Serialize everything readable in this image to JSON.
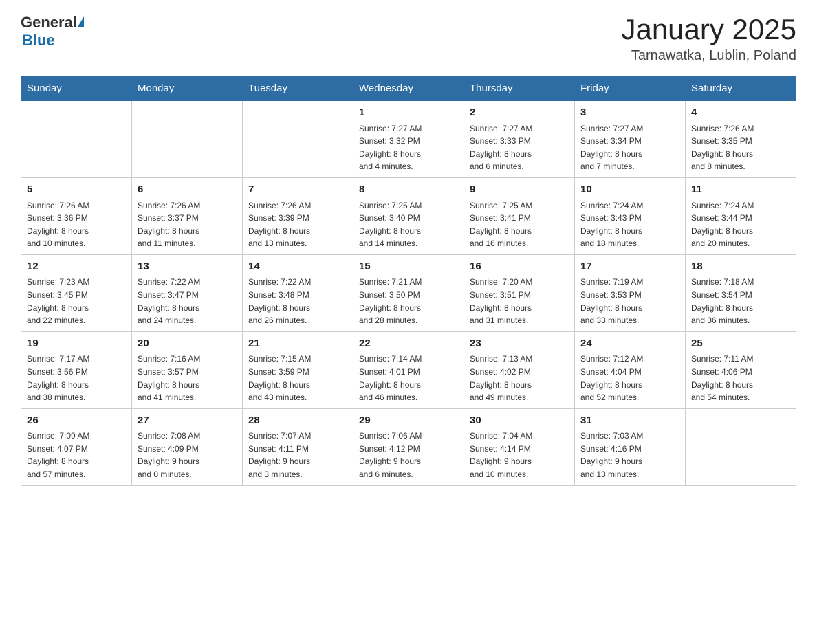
{
  "header": {
    "title": "January 2025",
    "subtitle": "Tarnawatka, Lublin, Poland",
    "logo_general": "General",
    "logo_blue": "Blue"
  },
  "weekdays": [
    "Sunday",
    "Monday",
    "Tuesday",
    "Wednesday",
    "Thursday",
    "Friday",
    "Saturday"
  ],
  "weeks": [
    [
      {
        "day": "",
        "info": ""
      },
      {
        "day": "",
        "info": ""
      },
      {
        "day": "",
        "info": ""
      },
      {
        "day": "1",
        "info": "Sunrise: 7:27 AM\nSunset: 3:32 PM\nDaylight: 8 hours\nand 4 minutes."
      },
      {
        "day": "2",
        "info": "Sunrise: 7:27 AM\nSunset: 3:33 PM\nDaylight: 8 hours\nand 6 minutes."
      },
      {
        "day": "3",
        "info": "Sunrise: 7:27 AM\nSunset: 3:34 PM\nDaylight: 8 hours\nand 7 minutes."
      },
      {
        "day": "4",
        "info": "Sunrise: 7:26 AM\nSunset: 3:35 PM\nDaylight: 8 hours\nand 8 minutes."
      }
    ],
    [
      {
        "day": "5",
        "info": "Sunrise: 7:26 AM\nSunset: 3:36 PM\nDaylight: 8 hours\nand 10 minutes."
      },
      {
        "day": "6",
        "info": "Sunrise: 7:26 AM\nSunset: 3:37 PM\nDaylight: 8 hours\nand 11 minutes."
      },
      {
        "day": "7",
        "info": "Sunrise: 7:26 AM\nSunset: 3:39 PM\nDaylight: 8 hours\nand 13 minutes."
      },
      {
        "day": "8",
        "info": "Sunrise: 7:25 AM\nSunset: 3:40 PM\nDaylight: 8 hours\nand 14 minutes."
      },
      {
        "day": "9",
        "info": "Sunrise: 7:25 AM\nSunset: 3:41 PM\nDaylight: 8 hours\nand 16 minutes."
      },
      {
        "day": "10",
        "info": "Sunrise: 7:24 AM\nSunset: 3:43 PM\nDaylight: 8 hours\nand 18 minutes."
      },
      {
        "day": "11",
        "info": "Sunrise: 7:24 AM\nSunset: 3:44 PM\nDaylight: 8 hours\nand 20 minutes."
      }
    ],
    [
      {
        "day": "12",
        "info": "Sunrise: 7:23 AM\nSunset: 3:45 PM\nDaylight: 8 hours\nand 22 minutes."
      },
      {
        "day": "13",
        "info": "Sunrise: 7:22 AM\nSunset: 3:47 PM\nDaylight: 8 hours\nand 24 minutes."
      },
      {
        "day": "14",
        "info": "Sunrise: 7:22 AM\nSunset: 3:48 PM\nDaylight: 8 hours\nand 26 minutes."
      },
      {
        "day": "15",
        "info": "Sunrise: 7:21 AM\nSunset: 3:50 PM\nDaylight: 8 hours\nand 28 minutes."
      },
      {
        "day": "16",
        "info": "Sunrise: 7:20 AM\nSunset: 3:51 PM\nDaylight: 8 hours\nand 31 minutes."
      },
      {
        "day": "17",
        "info": "Sunrise: 7:19 AM\nSunset: 3:53 PM\nDaylight: 8 hours\nand 33 minutes."
      },
      {
        "day": "18",
        "info": "Sunrise: 7:18 AM\nSunset: 3:54 PM\nDaylight: 8 hours\nand 36 minutes."
      }
    ],
    [
      {
        "day": "19",
        "info": "Sunrise: 7:17 AM\nSunset: 3:56 PM\nDaylight: 8 hours\nand 38 minutes."
      },
      {
        "day": "20",
        "info": "Sunrise: 7:16 AM\nSunset: 3:57 PM\nDaylight: 8 hours\nand 41 minutes."
      },
      {
        "day": "21",
        "info": "Sunrise: 7:15 AM\nSunset: 3:59 PM\nDaylight: 8 hours\nand 43 minutes."
      },
      {
        "day": "22",
        "info": "Sunrise: 7:14 AM\nSunset: 4:01 PM\nDaylight: 8 hours\nand 46 minutes."
      },
      {
        "day": "23",
        "info": "Sunrise: 7:13 AM\nSunset: 4:02 PM\nDaylight: 8 hours\nand 49 minutes."
      },
      {
        "day": "24",
        "info": "Sunrise: 7:12 AM\nSunset: 4:04 PM\nDaylight: 8 hours\nand 52 minutes."
      },
      {
        "day": "25",
        "info": "Sunrise: 7:11 AM\nSunset: 4:06 PM\nDaylight: 8 hours\nand 54 minutes."
      }
    ],
    [
      {
        "day": "26",
        "info": "Sunrise: 7:09 AM\nSunset: 4:07 PM\nDaylight: 8 hours\nand 57 minutes."
      },
      {
        "day": "27",
        "info": "Sunrise: 7:08 AM\nSunset: 4:09 PM\nDaylight: 9 hours\nand 0 minutes."
      },
      {
        "day": "28",
        "info": "Sunrise: 7:07 AM\nSunset: 4:11 PM\nDaylight: 9 hours\nand 3 minutes."
      },
      {
        "day": "29",
        "info": "Sunrise: 7:06 AM\nSunset: 4:12 PM\nDaylight: 9 hours\nand 6 minutes."
      },
      {
        "day": "30",
        "info": "Sunrise: 7:04 AM\nSunset: 4:14 PM\nDaylight: 9 hours\nand 10 minutes."
      },
      {
        "day": "31",
        "info": "Sunrise: 7:03 AM\nSunset: 4:16 PM\nDaylight: 9 hours\nand 13 minutes."
      },
      {
        "day": "",
        "info": ""
      }
    ]
  ]
}
